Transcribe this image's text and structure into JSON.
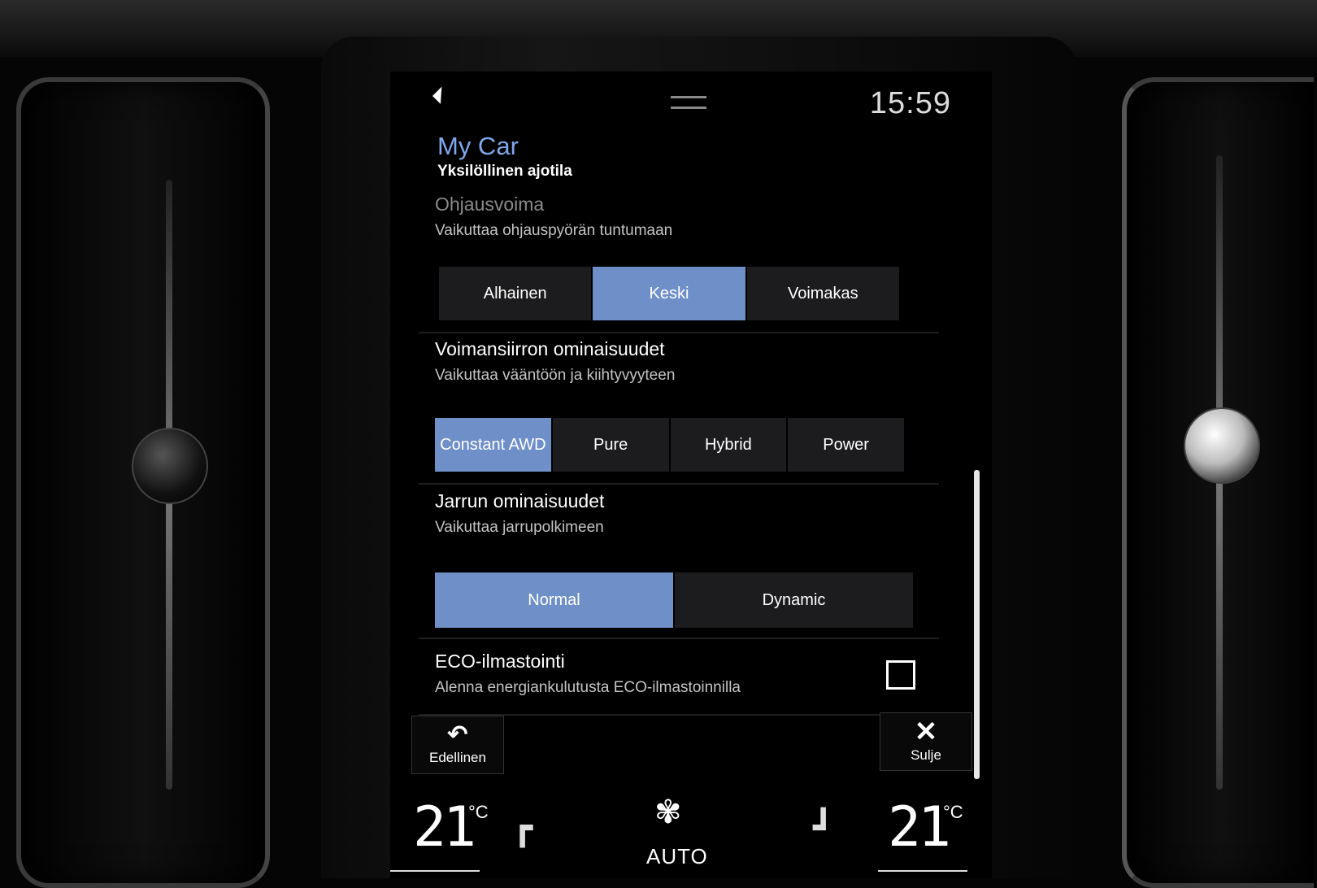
{
  "status": {
    "time": "15:59"
  },
  "header": {
    "title": "My Car",
    "subtitle": "Yksilöllinen ajotila"
  },
  "sections": {
    "steering": {
      "title": "Ohjausvoima",
      "desc": "Vaikuttaa ohjauspyörän tuntumaan",
      "options": [
        "Alhainen",
        "Keski",
        "Voimakas"
      ],
      "selected": "Keski"
    },
    "powertrain": {
      "title": "Voimansiirron ominaisuudet",
      "desc": "Vaikuttaa vääntöön ja kiihtyvyyteen",
      "options": [
        "Constant AWD",
        "Pure",
        "Hybrid",
        "Power"
      ],
      "selected": "Constant AWD"
    },
    "brake": {
      "title": "Jarrun ominaisuudet",
      "desc": "Vaikuttaa jarrupolkimeen",
      "options": [
        "Normal",
        "Dynamic"
      ],
      "selected": "Normal"
    },
    "eco": {
      "title": "ECO-ilmastointi",
      "desc": "Alenna energiankulutusta ECO-ilmastoinnilla",
      "checked": false
    }
  },
  "footer": {
    "back_label": "Edellinen",
    "close_label": "Sulje"
  },
  "climate": {
    "left_temp": "21",
    "right_temp": "21",
    "unit": "°C",
    "mode": "AUTO"
  },
  "colors": {
    "accent": "#6f8fc9",
    "title": "#7fa7ee"
  }
}
